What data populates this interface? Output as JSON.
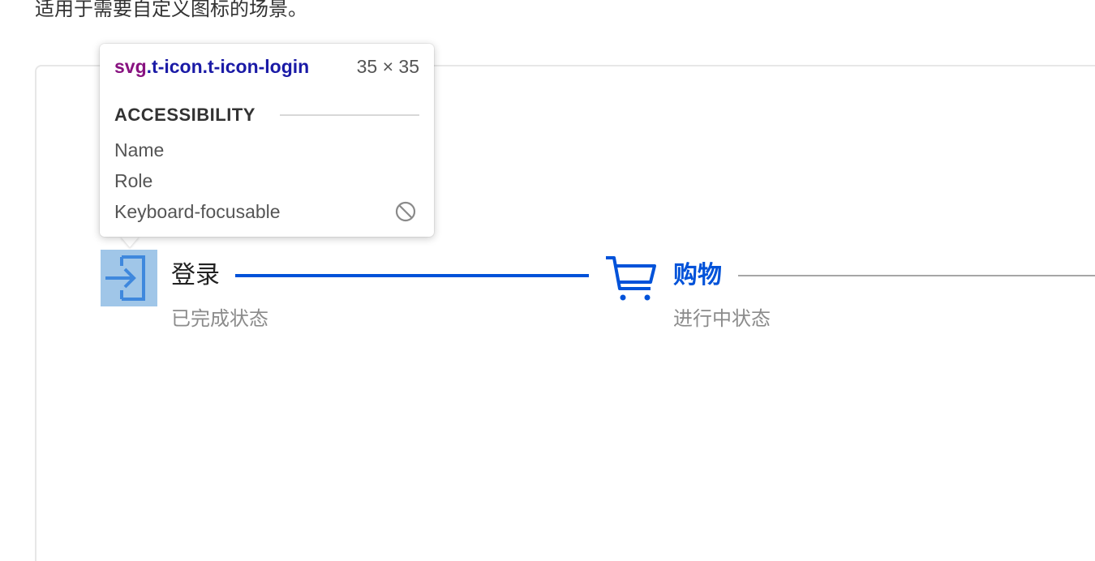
{
  "intro": {
    "text": "适用于需要自定义图标的场景。"
  },
  "steps": [
    {
      "icon": "login-icon",
      "title": "登录",
      "description": "已完成状态",
      "status": "finish"
    },
    {
      "icon": "cart-icon",
      "title": "购物",
      "description": "进行中状态",
      "status": "process"
    }
  ],
  "colors": {
    "brand": "#0052d9",
    "highlight": "#6fa8dc",
    "muted_text": "#8b8b8b",
    "inactive_line": "#a6a6a6"
  },
  "inspector": {
    "selector_tag": "svg",
    "selector_classes": ".t-icon.t-icon-login",
    "size": "35 × 35",
    "section_title": "ACCESSIBILITY",
    "rows": [
      {
        "label": "Name"
      },
      {
        "label": "Role"
      },
      {
        "label": "Keyboard-focusable",
        "icon": "no-entry-icon"
      }
    ]
  }
}
